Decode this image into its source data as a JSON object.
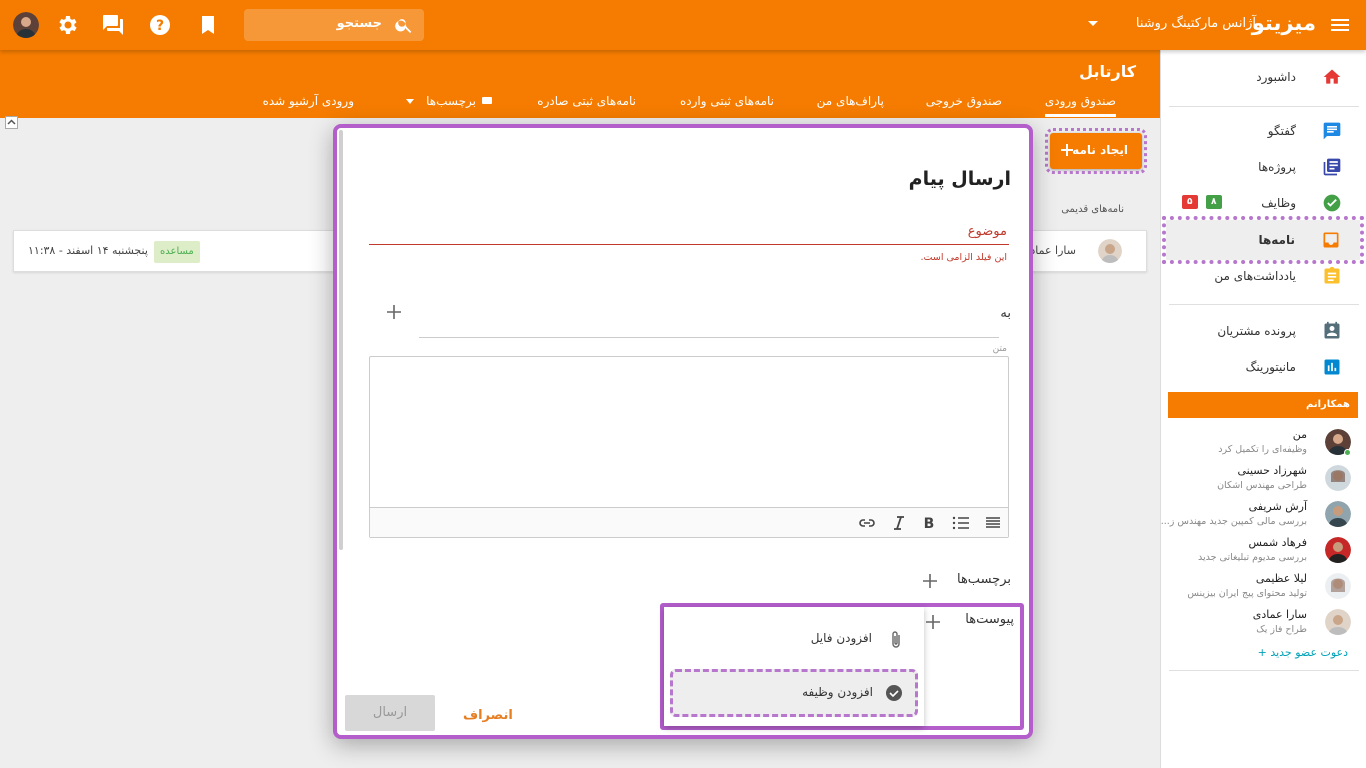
{
  "topbar": {
    "brand": "میزیتو",
    "agency": "آژانس مارکتینگ روشنا",
    "search_placeholder": "جستجو"
  },
  "header": {
    "title": "کارتابل",
    "tabs": [
      {
        "label": "صندوق ورودی",
        "active": true
      },
      {
        "label": "صندوق خروجی"
      },
      {
        "label": "پاراف‌های من"
      },
      {
        "label": "نامه‌های ثبتی وارده"
      },
      {
        "label": "نامه‌های ثبتی صادره"
      },
      {
        "label": "برچسب‌ها"
      },
      {
        "label": "ورودی آرشیو شده"
      }
    ]
  },
  "sidebar": {
    "items": [
      {
        "label": "داشبورد",
        "icon": "home-icon",
        "color": "#e53935"
      },
      {
        "label": "گفتگو",
        "icon": "chat-icon",
        "color": "#1e88e5"
      },
      {
        "label": "پروژه‌ها",
        "icon": "projects-icon",
        "color": "#3949ab"
      },
      {
        "label": "وظایف",
        "icon": "task-icon",
        "color": "#43a047",
        "badges": [
          "۸",
          "۵"
        ]
      },
      {
        "label": "نامه‌ها",
        "icon": "letters-icon",
        "color": "#f57c00",
        "active": true
      },
      {
        "label": "یادداشت‌های من",
        "icon": "notes-icon",
        "color": "#fbc02d"
      },
      {
        "label": "پرونده مشتریان",
        "icon": "customers-icon",
        "color": "#546e7a"
      },
      {
        "label": "مانیتورینگ",
        "icon": "monitoring-icon",
        "color": "#0288d1"
      }
    ],
    "colleagues_title": "همکارانم",
    "members": [
      {
        "name": "من",
        "sub": "وظیفه‌ای را تکمیل کرد"
      },
      {
        "name": "شهرزاد حسینی",
        "sub": "طراحی مهندس اشکان"
      },
      {
        "name": "آرش شریفی",
        "sub": "بررسی مالی کمپین جدید مهندس ز..."
      },
      {
        "name": "فرهاد شمس",
        "sub": "بررسی مدیوم تبلیغاتی جدید"
      },
      {
        "name": "لیلا عظیمی",
        "sub": "تولید محتوای پیج ایران بیزینس"
      },
      {
        "name": "سارا عمادی",
        "sub": "طراح فاز یک"
      }
    ],
    "invite": "دعوت عضو جدید"
  },
  "main": {
    "create_button": "ایجاد نامه",
    "old_letters": "نامه‌های قدیمی",
    "row": {
      "sender": "سارا عمادی",
      "tag": "مساعده",
      "date": "پنجشنبه ۱۴ اسفند - ۱۱:۳۸"
    }
  },
  "modal": {
    "title": "ارسال پیام",
    "subject_label": "موضوع",
    "subject_error": "این فیلد الزامی است.",
    "to_label": "به",
    "body_label": "متن",
    "labels_label": "برچسب‌ها",
    "attachments_label": "پیوست‌ها",
    "menu": {
      "add_file": "افزودن فایل",
      "add_task": "افزودن وظیفه"
    },
    "cancel": "انصراف",
    "send": "ارسال"
  }
}
